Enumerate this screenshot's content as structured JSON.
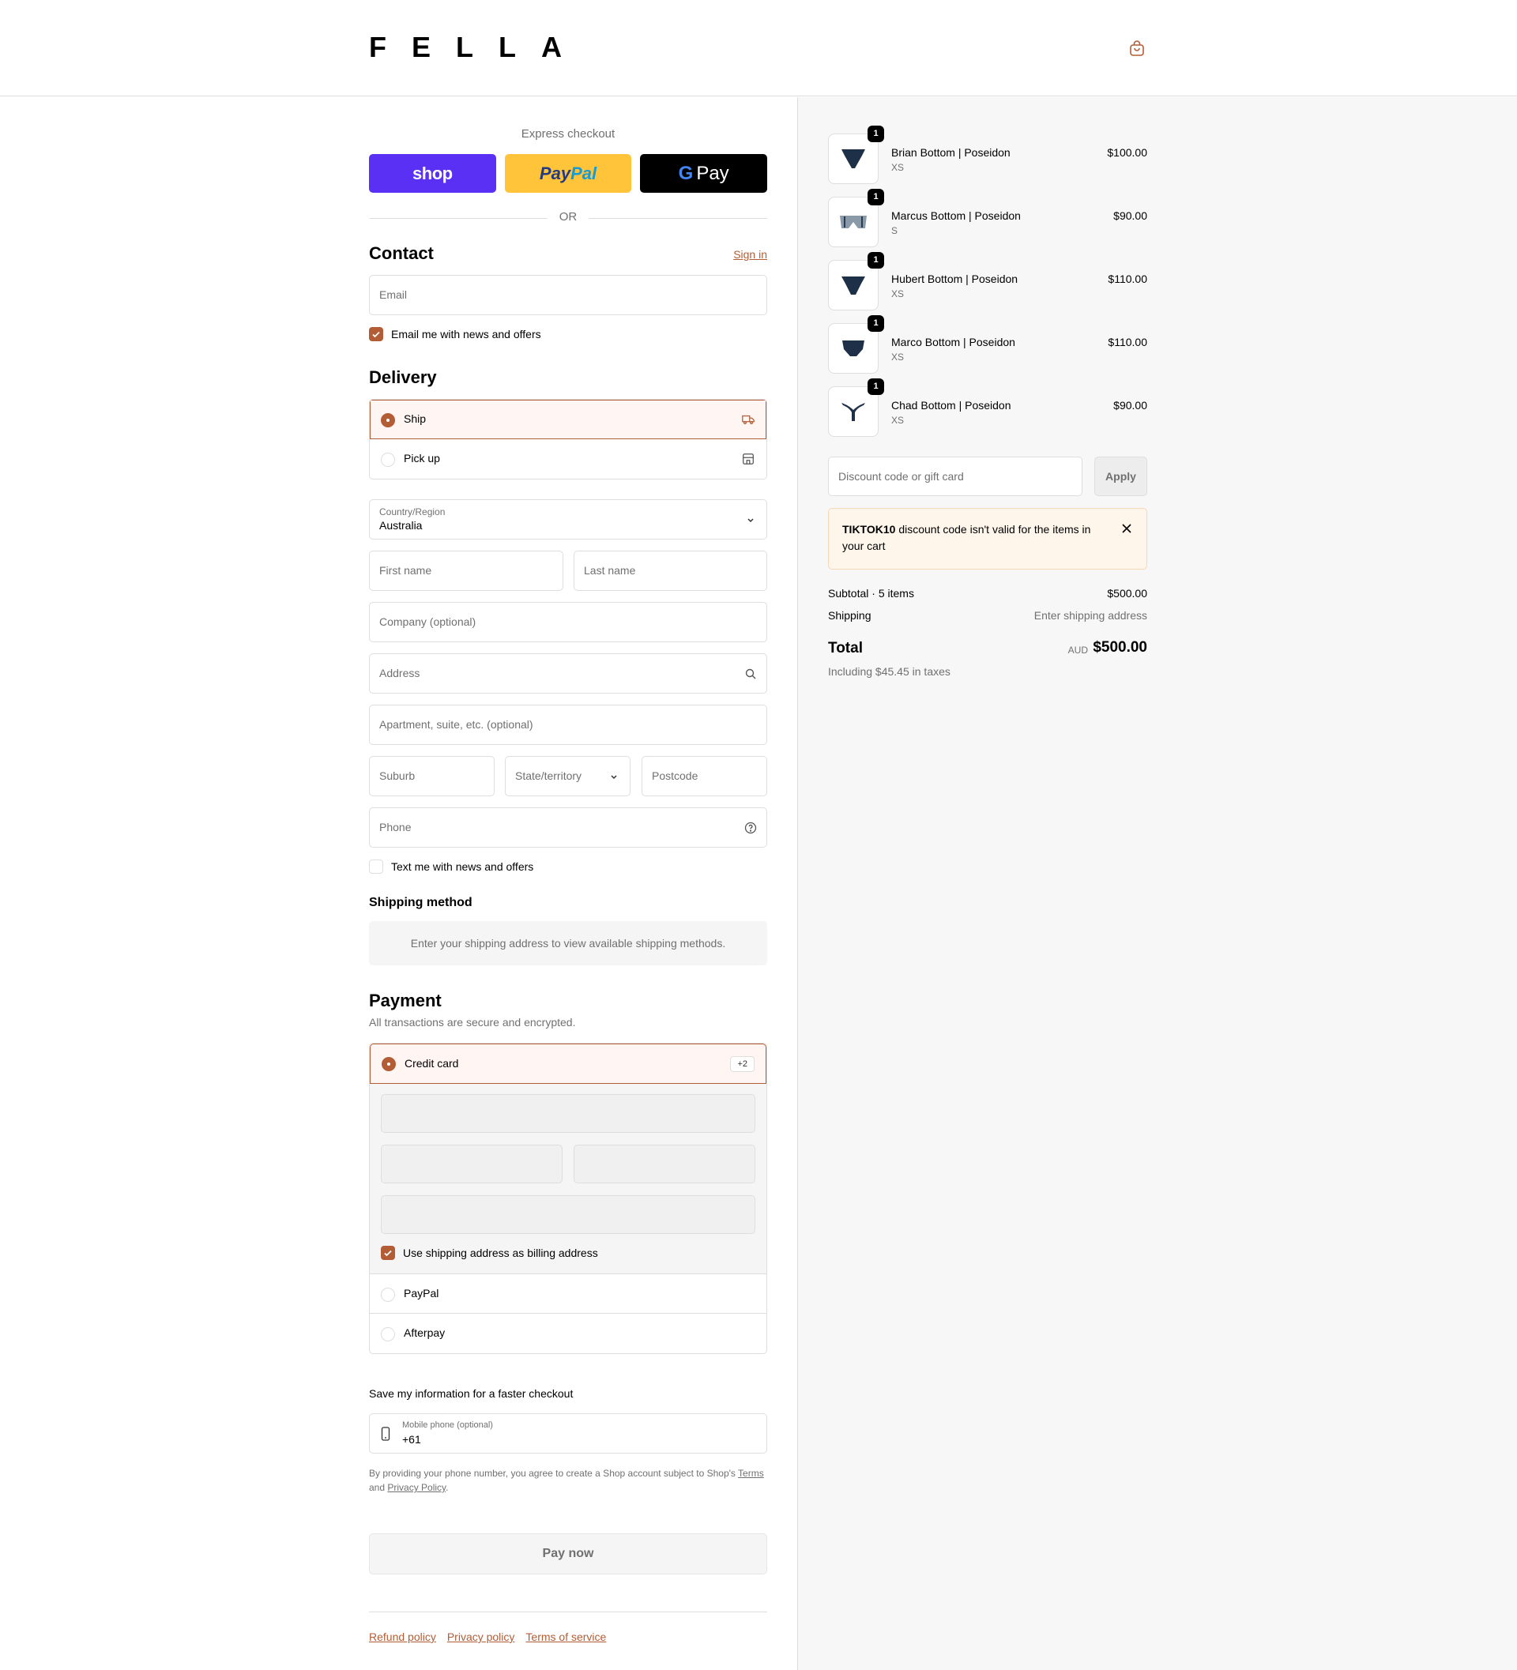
{
  "header": {
    "logo": "FELLA",
    "cart_icon": "shopping-bag-icon"
  },
  "express": {
    "title": "Express checkout",
    "shop_label": "shop",
    "paypal_label_1": "Pay",
    "paypal_label_2": "Pal",
    "gpay_g": "G",
    "gpay_label": "Pay",
    "or": "OR"
  },
  "contact": {
    "title": "Contact",
    "sign_in": "Sign in",
    "email_placeholder": "Email",
    "news_checkbox": "Email me with news and offers"
  },
  "delivery": {
    "title": "Delivery",
    "options": [
      "Ship",
      "Pick up"
    ],
    "country_label": "Country/Region",
    "country_value": "Australia",
    "first_name": "First name",
    "last_name": "Last name",
    "company": "Company (optional)",
    "address": "Address",
    "apartment": "Apartment, suite, etc. (optional)",
    "suburb": "Suburb",
    "state": "State/territory",
    "postcode": "Postcode",
    "phone": "Phone",
    "text_checkbox": "Text me with news and offers"
  },
  "shipping_method": {
    "title": "Shipping method",
    "note": "Enter your shipping address to view available shipping methods."
  },
  "payment": {
    "title": "Payment",
    "subtitle": "All transactions are secure and encrypted.",
    "credit_card": "Credit card",
    "badge": "+2",
    "billing_checkbox": "Use shipping address as billing address",
    "other_methods": [
      "PayPal",
      "Afterpay"
    ]
  },
  "save_info": {
    "title": "Save my information for a faster checkout",
    "mobile_label": "Mobile phone (optional)",
    "mobile_value": "+61",
    "terms_prefix": "By providing your phone number, you agree to create a Shop account subject to Shop's",
    "terms_link": "Terms",
    "terms_and": "and",
    "privacy_link": "Privacy Policy",
    "terms_suffix": "."
  },
  "pay_now": "Pay now",
  "footer_links": [
    "Refund policy",
    "Privacy policy",
    "Terms of service"
  ],
  "cart": {
    "items": [
      {
        "name": "Brian Bottom | Poseidon",
        "size": "XS",
        "price": "$100.00",
        "qty": "1"
      },
      {
        "name": "Marcus Bottom | Poseidon",
        "size": "S",
        "price": "$90.00",
        "qty": "1"
      },
      {
        "name": "Hubert Bottom | Poseidon",
        "size": "XS",
        "price": "$110.00",
        "qty": "1"
      },
      {
        "name": "Marco Bottom | Poseidon",
        "size": "XS",
        "price": "$110.00",
        "qty": "1"
      },
      {
        "name": "Chad Bottom | Poseidon",
        "size": "XS",
        "price": "$90.00",
        "qty": "1"
      }
    ],
    "discount_placeholder": "Discount code or gift card",
    "apply": "Apply",
    "alert_code": "TIKTOK10",
    "alert_text": " discount code isn't valid for the items in your cart",
    "subtotal_label": "Subtotal · 5 items",
    "subtotal_value": "$500.00",
    "shipping_label": "Shipping",
    "shipping_value": "Enter shipping address",
    "total_label": "Total",
    "total_currency": "AUD",
    "total_value": "$500.00",
    "taxes": "Including $45.45 in taxes"
  },
  "colors": {
    "accent": "#b25d35",
    "shop": "#5a31f4",
    "paypal": "#ffc439"
  }
}
